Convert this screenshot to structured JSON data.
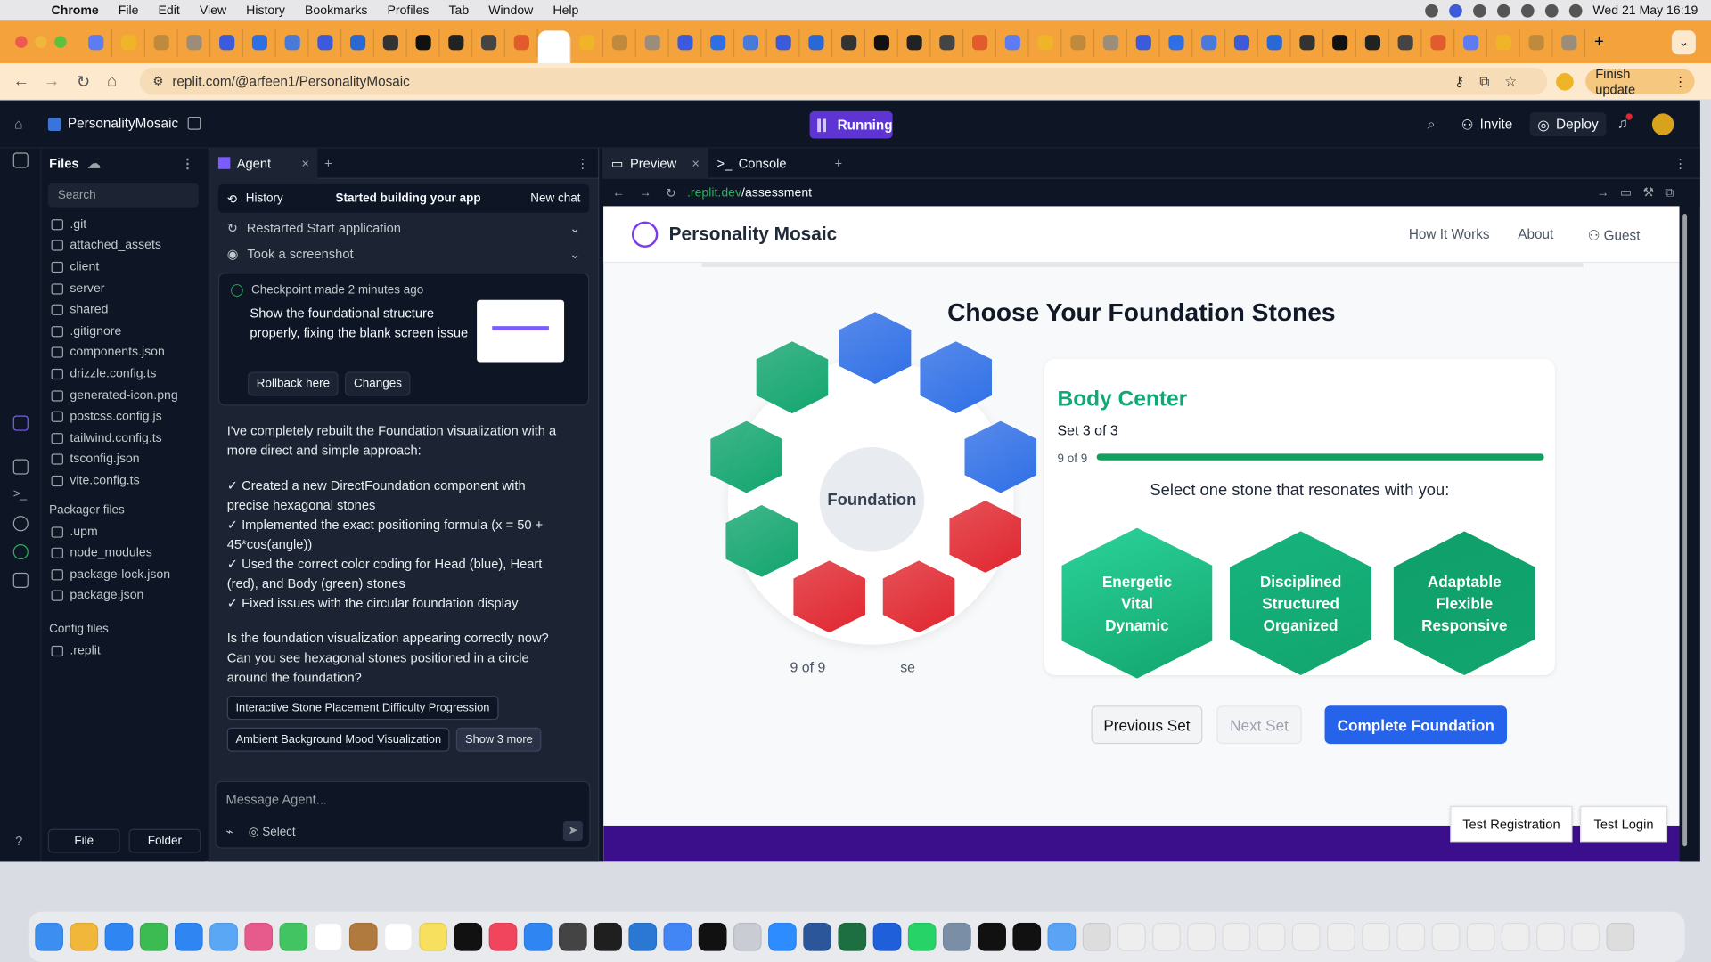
{
  "menubar": {
    "app": "Chrome",
    "items": [
      "File",
      "Edit",
      "View",
      "History",
      "Bookmarks",
      "Profiles",
      "Tab",
      "Window",
      "Help"
    ],
    "clock": "Wed 21 May  16:19"
  },
  "browser": {
    "url": "replit.com/@arfeen1/PersonalityMosaic",
    "finish_update": "Finish update",
    "tab_count": 46,
    "accent": "#f3a23c"
  },
  "replit": {
    "project": "PersonalityMosaic",
    "status": "Running",
    "invite": "Invite",
    "deploy": "Deploy",
    "files": {
      "title": "Files",
      "search": "Search",
      "items": [
        ".git",
        "attached_assets",
        "client",
        "server",
        "shared",
        ".gitignore",
        "components.json",
        "drizzle.config.ts",
        "generated-icon.png",
        "postcss.config.js",
        "tailwind.config.ts",
        "tsconfig.json",
        "vite.config.ts"
      ],
      "packager_title": "Packager files",
      "packager": [
        ".upm",
        "node_modules",
        "package-lock.json",
        "package.json"
      ],
      "config_title": "Config files",
      "config": [
        ".replit"
      ],
      "btn_file": "File",
      "btn_folder": "Folder"
    },
    "agent": {
      "tab": "Agent",
      "history": "History",
      "status": "Started building your app",
      "new_chat": "New chat",
      "event1": "Restarted Start application",
      "event2": "Took a screenshot",
      "checkpoint": "Checkpoint made 2 minutes ago",
      "checkpoint_text": "Show the foundational structure properly, fixing the blank screen issue",
      "rollback": "Rollback here",
      "changes": "Changes",
      "msg_intro": "I've completely rebuilt the Foundation visualization with a more direct and simple approach:",
      "bullets": [
        "✓ Created a new DirectFoundation component with precise hexagonal stones",
        "✓ Implemented the exact positioning formula (x = 50 + 45*cos(angle))",
        "✓ Used the correct color coding for Head (blue), Heart (red), and Body (green) stones",
        "✓ Fixed issues with the circular foundation display"
      ],
      "question": "Is the foundation visualization appearing correctly now? Can you see hexagonal stones positioned in a circle around the foundation?",
      "sugg1": "Interactive Stone Placement Difficulty Progression",
      "sugg2": "Ambient Background Mood Visualization",
      "sugg_more": "Show 3 more",
      "placeholder": "Message Agent...",
      "select": "Select"
    },
    "preview": {
      "tab": "Preview",
      "console": "Console",
      "url_host": ".replit.dev",
      "url_path": "/assessment"
    }
  },
  "app": {
    "brand": "Personality Mosaic",
    "nav": [
      "How It Works",
      "About"
    ],
    "guest": "Guest",
    "title": "Choose Your Foundation Stones",
    "foundation_label": "Foundation",
    "foundation_count": "9 of 9",
    "foundation_suffix": "se",
    "center": "Body Center",
    "set": "Set 3 of 3",
    "progress_label": "9 of 9",
    "progress": 1.0,
    "prompt": "Select one stone that resonates with you:",
    "stones": [
      [
        "Energetic",
        "Vital",
        "Dynamic"
      ],
      [
        "Disciplined",
        "Structured",
        "Organized"
      ],
      [
        "Adaptable",
        "Flexible",
        "Responsive"
      ]
    ],
    "prev": "Previous Set",
    "next": "Next Set",
    "complete": "Complete Foundation",
    "test_reg": "Test Registration",
    "test_login": "Test Login",
    "colors": {
      "head": "#2f6fe6",
      "heart": "#e0262f",
      "body": "#12a56e",
      "primary": "#2563eb"
    }
  }
}
